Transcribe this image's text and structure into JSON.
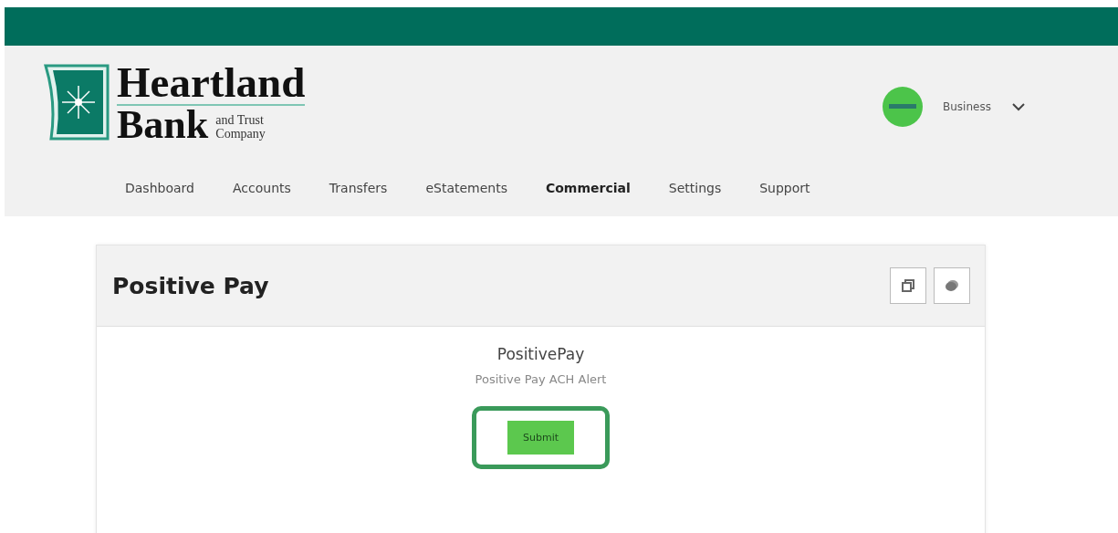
{
  "logo": {
    "line_1": "Heartland",
    "line_2": "Bank",
    "line_3": "and Trust",
    "line_4": "Company"
  },
  "account": {
    "label": "Business"
  },
  "nav": [
    {
      "label": "Dashboard",
      "selected": false
    },
    {
      "label": "Accounts",
      "selected": false
    },
    {
      "label": "Transfers",
      "selected": false
    },
    {
      "label": "eStatements",
      "selected": false
    },
    {
      "label": "Commercial",
      "selected": true
    },
    {
      "label": "Settings",
      "selected": false
    },
    {
      "label": "Support",
      "selected": false
    }
  ],
  "card": {
    "title": "Positive Pay",
    "heading": "PositivePay",
    "subtitle": "Positive Pay ACH Alert",
    "button": "Submit",
    "button_highlighted": true
  }
}
